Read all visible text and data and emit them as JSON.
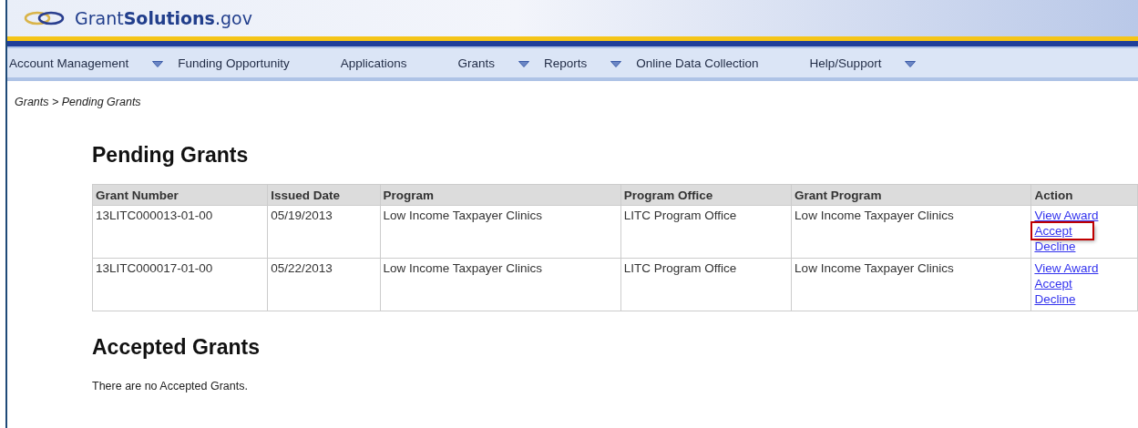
{
  "logo": {
    "text": "Grant**Solutions**.gov"
  },
  "nav": [
    {
      "label": "Account Management",
      "has_dropdown": true
    },
    {
      "label": "Funding Opportunity",
      "has_dropdown": false
    },
    {
      "label": "Applications",
      "has_dropdown": false
    },
    {
      "label": "Grants",
      "has_dropdown": true
    },
    {
      "label": "Reports",
      "has_dropdown": true
    },
    {
      "label": "Online Data Collection",
      "has_dropdown": false
    },
    {
      "label": "Help/Support",
      "has_dropdown": true
    }
  ],
  "breadcrumb": "Grants > Pending Grants",
  "pending": {
    "heading": "Pending Grants",
    "columns": [
      "Grant Number",
      "Issued Date",
      "Program",
      "Program Office",
      "Grant Program",
      "Action"
    ],
    "rows": [
      {
        "cells": [
          "13LITC000013-01-00",
          "05/19/2013",
          "Low Income Taxpayer Clinics",
          "LITC Program Office",
          "Low Income Taxpayer Clinics"
        ],
        "actions": [
          {
            "label": "View Award",
            "highlighted": false
          },
          {
            "label": "Accept",
            "highlighted": true
          },
          {
            "label": "Decline",
            "highlighted": false
          }
        ]
      },
      {
        "cells": [
          "13LITC000017-01-00",
          "05/22/2013",
          "Low Income Taxpayer Clinics",
          "LITC Program Office",
          "Low Income Taxpayer Clinics"
        ],
        "actions": [
          {
            "label": "View Award",
            "highlighted": false
          },
          {
            "label": "Accept",
            "highlighted": false
          },
          {
            "label": "Decline",
            "highlighted": false
          }
        ]
      }
    ]
  },
  "accepted": {
    "heading": "Accepted Grants",
    "message": "There are no Accepted Grants."
  }
}
